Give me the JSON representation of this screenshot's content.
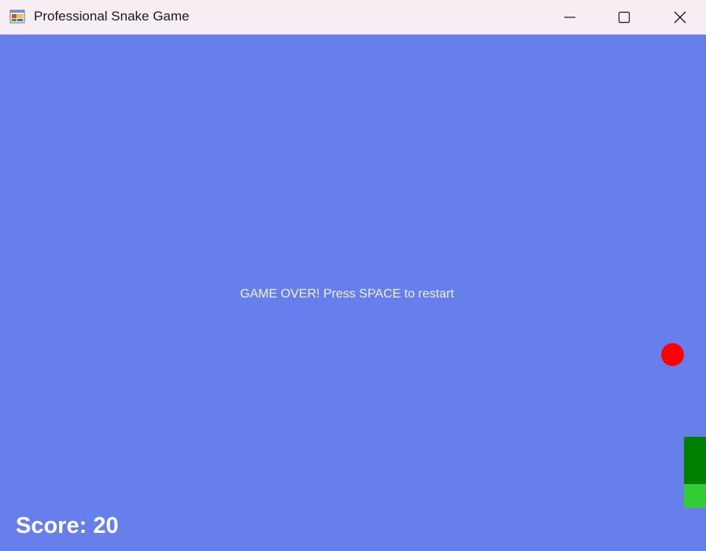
{
  "window": {
    "title": "Professional Snake Game",
    "icon": "app-window-icon"
  },
  "titlebar_buttons": {
    "minimize_icon": "minimize-icon",
    "maximize_icon": "maximize-icon",
    "close_icon": "close-icon"
  },
  "game": {
    "background_color": "#677fea",
    "message": "GAME OVER! Press SPACE to restart",
    "score_text": "Score: 20",
    "food_color": "#ff0000",
    "snake_head_color": "#008000",
    "snake_body_color": "#33cc33"
  }
}
